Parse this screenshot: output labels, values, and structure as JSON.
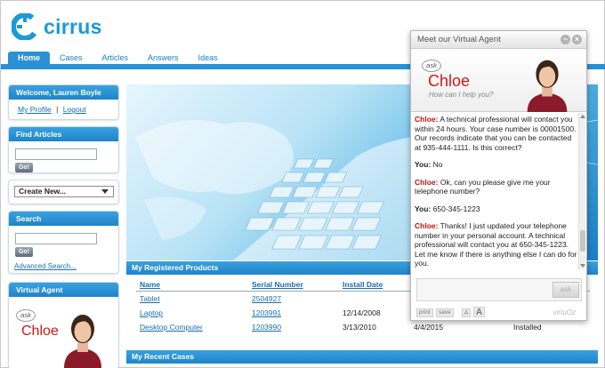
{
  "app": {
    "logo_text": "cirrus"
  },
  "nav": {
    "tabs": [
      {
        "label": "Home",
        "active": true
      },
      {
        "label": "Cases"
      },
      {
        "label": "Articles"
      },
      {
        "label": "Answers"
      },
      {
        "label": "Ideas"
      }
    ]
  },
  "sidebar": {
    "welcome": {
      "title": "Welcome, Lauren Boyle",
      "profile_link": "My Profile",
      "separator": "|",
      "logout_link": "Logout"
    },
    "find_articles": {
      "title": "Find Articles",
      "go": "Go!"
    },
    "create_new": {
      "label": "Create New..."
    },
    "search": {
      "title": "Search",
      "go": "Go!",
      "advanced": "Advanced Search..."
    },
    "virtual_agent": {
      "title": "Virtual Agent",
      "ask": "ask",
      "name": "Chloe"
    }
  },
  "products": {
    "title": "My Registered Products",
    "columns": [
      "Name",
      "Serial Number",
      "Install Date"
    ],
    "rows": [
      {
        "name": "Tablet",
        "serial": "2504927",
        "install": "",
        "extra1": "",
        "extra2": ""
      },
      {
        "name": "Laptop",
        "serial": "1203991",
        "install": "12/14/2008",
        "extra1": "",
        "extra2": ""
      },
      {
        "name": "Desktop Computer",
        "serial": "1203990",
        "install": "3/13/2010",
        "extra1": "4/4/2015",
        "extra2": "Installed"
      }
    ]
  },
  "recent_cases": {
    "title": "My Recent Cases"
  },
  "chat": {
    "title": "Meet our Virtual Agent",
    "ask": "ask",
    "agent_name": "Chloe",
    "agent_sub": "How can I help you?",
    "messages": [
      {
        "speaker": "Chloe:",
        "text": "A technical professional will contact you within 24 hours. Your case number is 00001500. Our records indicate that you can be contacted at 935-444-1111. Is this correct?"
      },
      {
        "speaker": "You:",
        "text": "No"
      },
      {
        "speaker": "Chloe:",
        "text": "Ok, can you please give me your telephone number?"
      },
      {
        "speaker": "You:",
        "text": "650-345-1223"
      },
      {
        "speaker": "Chloe:",
        "text": "Thanks! I just updated your telephone number in your personal account. A technical professional will contact you at 650-345-1223. Let me know if there is anything else I can do for you."
      }
    ],
    "ask_button": "ask",
    "print": "print",
    "save": "save",
    "font_small": "A",
    "font_large": "A",
    "brand": "virtuOz"
  },
  "colors": {
    "accent": "#2a91d6",
    "chloe_red": "#d01717"
  },
  "icons": [
    "cirrus-logo-icon",
    "minimize-icon",
    "close-icon",
    "dropdown-arrow-icon"
  ]
}
